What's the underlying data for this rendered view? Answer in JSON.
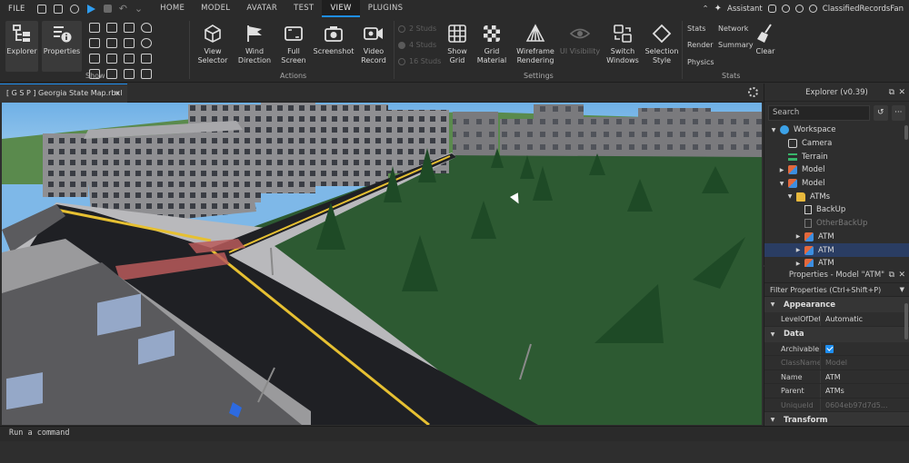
{
  "menu": {
    "file": "FILE",
    "tabs": [
      "HOME",
      "MODEL",
      "AVATAR",
      "TEST",
      "VIEW",
      "PLUGINS"
    ],
    "active_tab": "VIEW",
    "assistant": "Assistant",
    "username": "ClassifiedRecordsFan"
  },
  "ribbon": {
    "show_group": {
      "label": "Show",
      "explorer": "Explorer",
      "properties": "Properties"
    },
    "actions_group": {
      "label": "Actions",
      "view_selector": [
        "View",
        "Selector"
      ],
      "wind_direction": [
        "Wind",
        "Direction"
      ],
      "full_screen": [
        "Full",
        "Screen"
      ],
      "screenshot": "Screenshot",
      "video_record": [
        "Video",
        "Record"
      ]
    },
    "settings_group": {
      "label": "Settings",
      "studs": [
        "2 Studs",
        "4 Studs",
        "16 Studs"
      ],
      "show_grid": [
        "Show",
        "Grid"
      ],
      "grid_material": [
        "Grid",
        "Material"
      ],
      "wireframe": [
        "Wireframe",
        "Rendering"
      ],
      "ui_visibility": "UI Visibility",
      "switch_windows": [
        "Switch",
        "Windows"
      ],
      "selection_style": [
        "Selection",
        "Style"
      ]
    },
    "stats_group": {
      "label": "Stats",
      "stats": "Stats",
      "network": "Network",
      "render": "Render",
      "summary": "Summary",
      "physics": "Physics",
      "clear": "Clear"
    }
  },
  "document": {
    "tab_title": "[ G S P ] Georgia State Map.rbxl",
    "close": "×"
  },
  "command_bar": {
    "placeholder": "Run a command"
  },
  "explorer": {
    "title": "Explorer (v0.39)",
    "search_placeholder": "Search",
    "items": [
      {
        "label": "Workspace",
        "depth": 0,
        "arrow": "▼",
        "icon": "workspace-icon",
        "color": "#3ca2e8"
      },
      {
        "label": "Camera",
        "depth": 1,
        "arrow": "",
        "icon": "camera-icon",
        "color": "#d0d0d0"
      },
      {
        "label": "Terrain",
        "depth": 1,
        "arrow": "",
        "icon": "terrain-icon",
        "color": "#38b56a"
      },
      {
        "label": "Model",
        "depth": 1,
        "arrow": "▶",
        "icon": "model-icon",
        "color": "#e2683c"
      },
      {
        "label": "Model",
        "depth": 1,
        "arrow": "▼",
        "icon": "model-icon",
        "color": "#e2683c"
      },
      {
        "label": "ATMs",
        "depth": 2,
        "arrow": "▼",
        "icon": "folder-icon",
        "color": "#e8b93c"
      },
      {
        "label": "BackUp",
        "depth": 3,
        "arrow": "",
        "icon": "script-icon",
        "color": "#cfcfcf"
      },
      {
        "label": "OtherBackUp",
        "depth": 3,
        "arrow": "",
        "icon": "script-icon",
        "color": "#7a7a7a"
      },
      {
        "label": "ATM",
        "depth": 3,
        "arrow": "▶",
        "icon": "model-icon",
        "color": "#e2683c"
      },
      {
        "label": "ATM",
        "depth": 3,
        "arrow": "▶",
        "icon": "model-icon",
        "color": "#e2683c"
      },
      {
        "label": "ATM",
        "depth": 3,
        "arrow": "▶",
        "icon": "model-icon",
        "color": "#e2683c"
      }
    ],
    "selected_index": 9,
    "dim_index": 7
  },
  "properties": {
    "title": "Properties - Model \"ATM\"",
    "filter": "Filter Properties (Ctrl+Shift+P)",
    "categories": [
      {
        "name": "Appearance",
        "rows": [
          {
            "name": "LevelOfDetail",
            "value": "Automatic"
          }
        ]
      },
      {
        "name": "Data",
        "rows": [
          {
            "name": "Archivable",
            "value": "",
            "checkbox": true
          },
          {
            "name": "ClassName",
            "value": "Model",
            "dim": true
          },
          {
            "name": "Name",
            "value": "ATM"
          },
          {
            "name": "Parent",
            "value": "ATMs"
          },
          {
            "name": "UniqueId",
            "value": "0604eb97d7d5...",
            "dim": true
          }
        ]
      },
      {
        "name": "Transform",
        "rows": []
      }
    ]
  },
  "colors": {
    "accent": "#1e8ef0",
    "grass": "#2d5a32",
    "road": "#1e1e22",
    "sky": "#7eb8e8"
  }
}
